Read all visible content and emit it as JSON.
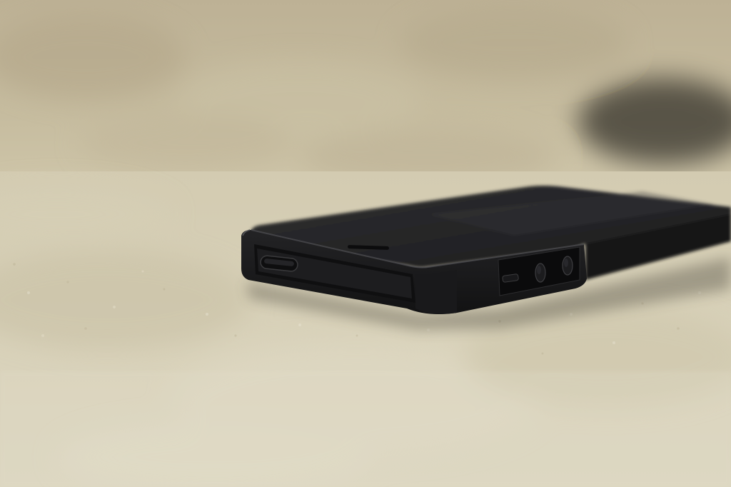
{
  "photo": {
    "subject": "smartphone",
    "palette": {
      "wall": "#c3b89c",
      "surface": "#d6d0b8",
      "phone_body": "#1b1b1d",
      "phone_screen": "#2a2a2c"
    }
  }
}
